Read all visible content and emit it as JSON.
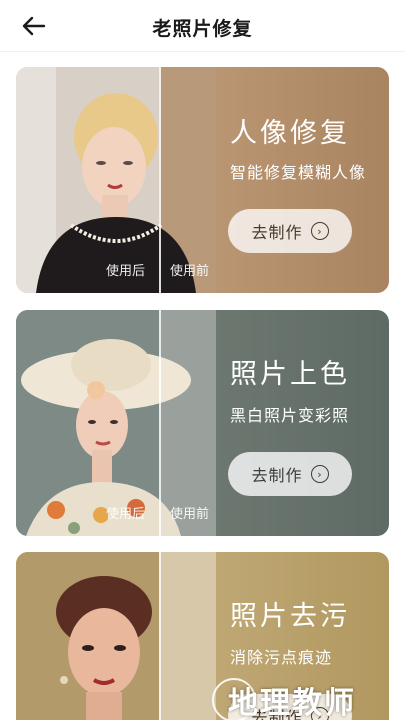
{
  "header": {
    "title": "老照片修复"
  },
  "cards": [
    {
      "title": "人像修复",
      "subtitle": "智能修复模糊人像",
      "button": "去制作",
      "after_label": "使用后",
      "before_label": "使用前",
      "accent": "#b8936f"
    },
    {
      "title": "照片上色",
      "subtitle": "黑白照片变彩照",
      "button": "去制作",
      "after_label": "使用后",
      "before_label": "使用前",
      "accent": "#6c7770"
    },
    {
      "title": "照片去污",
      "subtitle": "消除污点痕迹",
      "button": "去制作",
      "accent": "#bfa774"
    }
  ],
  "icons": {
    "back": "arrow-left-icon",
    "go": "chevron-right-circle-icon"
  },
  "watermark": "地理教师"
}
